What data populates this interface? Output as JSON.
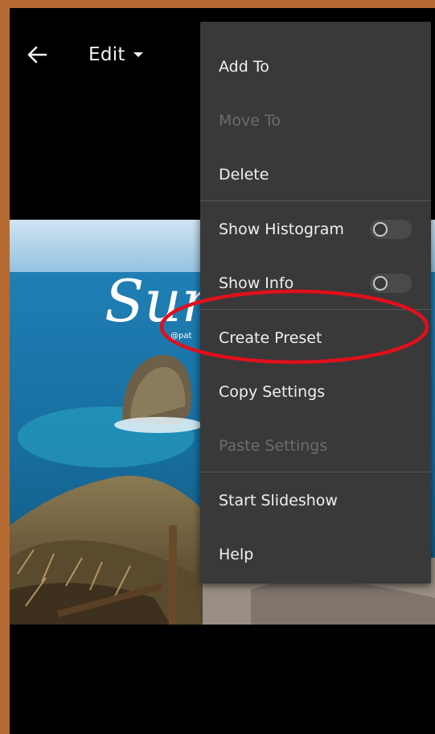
{
  "topbar": {
    "back_icon": "arrow-left-icon",
    "edit_label": "Edit",
    "edit_caret_icon": "caret-down-icon"
  },
  "photo": {
    "overlay_title": "Sun",
    "overlay_handle": "@pat"
  },
  "menu": {
    "items": [
      {
        "label": "Add To",
        "enabled": true
      },
      {
        "label": "Move To",
        "enabled": false
      },
      {
        "label": "Delete",
        "enabled": true
      },
      {
        "label": "Show Histogram",
        "enabled": true,
        "toggle": false
      },
      {
        "label": "Show Info",
        "enabled": true,
        "toggle": false
      },
      {
        "label": "Create Preset",
        "enabled": true
      },
      {
        "label": "Copy Settings",
        "enabled": true
      },
      {
        "label": "Paste Settings",
        "enabled": false
      },
      {
        "label": "Start Slideshow",
        "enabled": true
      },
      {
        "label": "Help",
        "enabled": true
      }
    ]
  },
  "highlight_color": "#e0101c",
  "colors": {
    "frame": "#b56a32",
    "menu_bg": "#393939",
    "menu_text": "#f0f0f0",
    "menu_disabled_text": "#6c6c6c"
  }
}
